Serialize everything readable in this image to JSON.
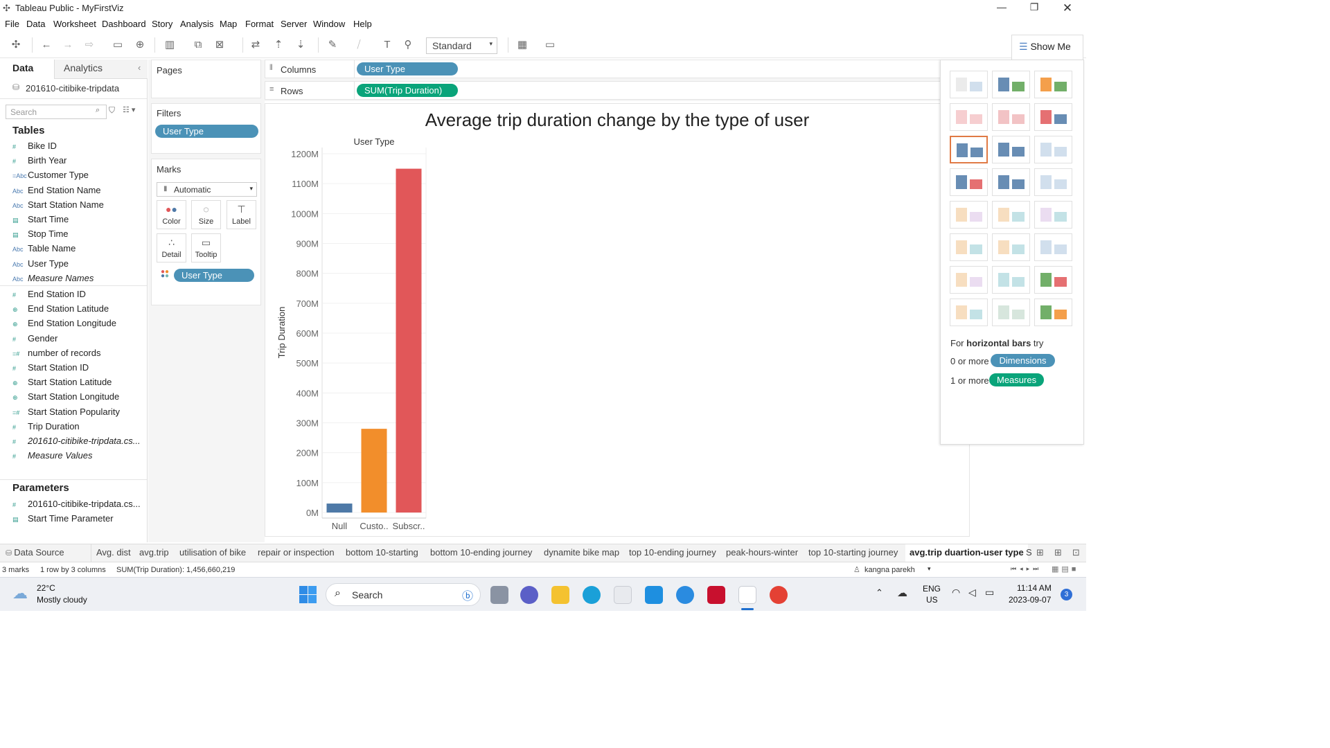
{
  "window": {
    "title": "Tableau Public - MyFirstViz"
  },
  "menu": [
    "File",
    "Data",
    "Worksheet",
    "Dashboard",
    "Story",
    "Analysis",
    "Map",
    "Format",
    "Server",
    "Window",
    "Help"
  ],
  "toolbar": {
    "fit_mode": "Standard",
    "show_me_label": "Show Me"
  },
  "datapane": {
    "tab_data": "Data",
    "tab_analytics": "Analytics",
    "datasource": "201610-citibike-tripdata",
    "search_placeholder": "Search",
    "tables_heading": "Tables",
    "dimensions": [
      {
        "icon": "#",
        "label": "Bike ID"
      },
      {
        "icon": "#",
        "label": "Birth Year"
      },
      {
        "icon": "=Abc",
        "label": "Customer Type"
      },
      {
        "icon": "Abc",
        "label": "End Station Name"
      },
      {
        "icon": "Abc",
        "label": "Start Station Name"
      },
      {
        "icon": "cal",
        "label": "Start Time"
      },
      {
        "icon": "cal",
        "label": "Stop Time"
      },
      {
        "icon": "Abc",
        "label": "Table Name"
      },
      {
        "icon": "Abc",
        "label": "User Type"
      },
      {
        "icon": "Abc",
        "label": "Measure Names"
      }
    ],
    "measures": [
      {
        "icon": "#",
        "label": "End Station ID"
      },
      {
        "icon": "globe",
        "label": "End Station Latitude"
      },
      {
        "icon": "globe",
        "label": "End Station Longitude"
      },
      {
        "icon": "#",
        "label": "Gender"
      },
      {
        "icon": "=#",
        "label": "number of records"
      },
      {
        "icon": "#",
        "label": "Start Station ID"
      },
      {
        "icon": "globe",
        "label": "Start Station Latitude"
      },
      {
        "icon": "globe",
        "label": "Start Station Longitude"
      },
      {
        "icon": "=#",
        "label": "Start Station Popularity"
      },
      {
        "icon": "#",
        "label": "Trip Duration"
      },
      {
        "icon": "#",
        "label": "201610-citibike-tripdata.cs..."
      },
      {
        "icon": "#",
        "label": "Measure Values"
      }
    ],
    "parameters_heading": "Parameters",
    "parameters": [
      {
        "icon": "#",
        "label": "201610-citibike-tripdata.cs..."
      },
      {
        "icon": "cal",
        "label": "Start Time Parameter"
      }
    ]
  },
  "cards": {
    "pages": "Pages",
    "filters": "Filters",
    "filter_pill": "User Type",
    "marks": "Marks",
    "mark_type": "Automatic",
    "mark_buttons": [
      "Color",
      "Size",
      "Label",
      "Detail",
      "Tooltip"
    ],
    "marks_pill": "User Type"
  },
  "shelves": {
    "columns_label": "Columns",
    "columns_pill": "User Type",
    "rows_label": "Rows",
    "rows_pill": "SUM(Trip Duration)"
  },
  "chart_data": {
    "type": "bar",
    "title": "Average trip duration change by the type of user",
    "column_header": "User Type",
    "ylabel": "Trip Duration",
    "categories": [
      "Null",
      "Custo..",
      "Subscr.."
    ],
    "values": [
      30,
      280,
      1150
    ],
    "colors": [
      "#4e79a7",
      "#f28e2b",
      "#e15759"
    ],
    "unit": "M",
    "ylim": [
      0,
      1200
    ],
    "yticks": [
      "0M",
      "100M",
      "200M",
      "300M",
      "400M",
      "500M",
      "600M",
      "700M",
      "800M",
      "900M",
      "1000M",
      "1100M",
      "1200M"
    ]
  },
  "showme": {
    "hint_prefix": "For ",
    "hint_bold": "horizontal bars",
    "hint_suffix": " try",
    "dim_prefix": "0 or more",
    "dim_pill": "Dimensions",
    "meas_prefix": "1 or more",
    "meas_pill": "Measures"
  },
  "sheettabs": {
    "datasource": "Data Source",
    "tabs": [
      "Avg. dist",
      "avg.trip",
      "utilisation of bike",
      "repair or inspection",
      "bottom 10-starting",
      "bottom 10-ending journey",
      "dynamite bike map",
      "top 10-ending journey",
      "peak-hours-winter",
      "top 10-starting journey"
    ],
    "active": "avg.trip duartion-user type",
    "overflow": "S"
  },
  "status": {
    "marks": "3 marks",
    "shape": "1 row by 3 columns",
    "sum": "SUM(Trip Duration): 1,456,660,219",
    "user": "kangna parekh"
  },
  "taskbar": {
    "temp": "22°C",
    "weather": "Mostly cloudy",
    "search": "Search",
    "lang1": "ENG",
    "lang2": "US",
    "time": "11:14 AM",
    "date": "2023-09-07",
    "badge": "3"
  }
}
